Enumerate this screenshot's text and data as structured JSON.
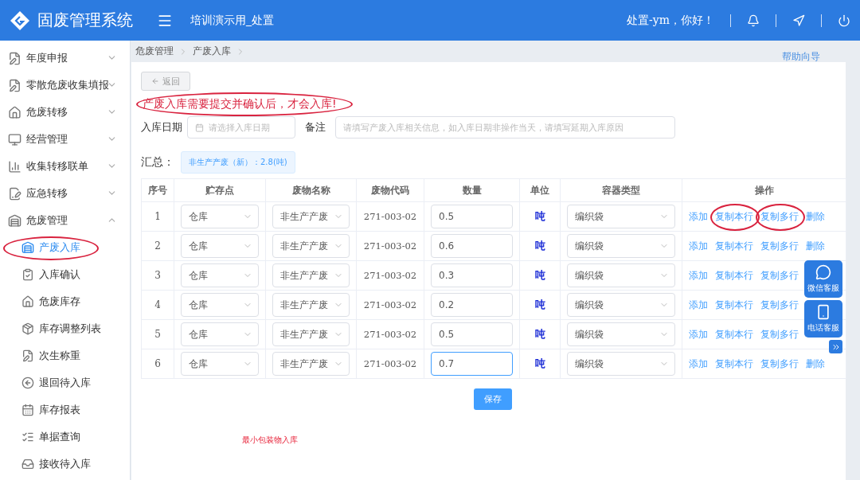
{
  "header": {
    "title": "固废管理系统",
    "org": "培训演示用_处置",
    "greeting": "处置-ym，你好！"
  },
  "sidebar": {
    "items": [
      {
        "label": "年度申报",
        "expanded": false
      },
      {
        "label": "零散危废收集填报",
        "expanded": false
      },
      {
        "label": "危废转移",
        "expanded": false
      },
      {
        "label": "经营管理",
        "expanded": false
      },
      {
        "label": "收集转移联单",
        "expanded": false
      },
      {
        "label": "应急转移",
        "expanded": false
      },
      {
        "label": "危废管理",
        "expanded": true,
        "children": [
          {
            "label": "产废入库",
            "selected": true,
            "circled": true
          },
          {
            "label": "入库确认",
            "selected": false,
            "circled": false
          },
          {
            "label": "危废库存",
            "selected": false,
            "circled": false
          },
          {
            "label": "库存调整列表",
            "selected": false,
            "circled": false
          },
          {
            "label": "次生称重",
            "selected": false,
            "circled": false
          },
          {
            "label": "退回待入库",
            "selected": false,
            "circled": false
          },
          {
            "label": "库存报表",
            "selected": false,
            "circled": false
          },
          {
            "label": "单据查询",
            "selected": false,
            "circled": false
          },
          {
            "label": "接收待入库",
            "selected": false,
            "circled": false
          }
        ]
      }
    ]
  },
  "breadcrumb": [
    "危废管理",
    "产废入库"
  ],
  "help_link": "帮助向导",
  "back_button": "返回",
  "notice": {
    "text": "产废入库需要提交并确认后，才会入库!",
    "circled": true
  },
  "form": {
    "date_label": "入库日期",
    "date_placeholder": "请选择入库日期",
    "remark_label": "备注",
    "remark_placeholder": "请填写产废入库相关信息，如入库日期非操作当天，请填写延期入库原因"
  },
  "summary": {
    "label": "汇总：",
    "tag": "非生产产废（新）：2.8(吨)"
  },
  "table": {
    "columns": [
      "序号",
      "贮存点",
      "废物名称",
      "废物代码",
      "数量",
      "单位",
      "容器类型",
      "操作"
    ],
    "rows": [
      {
        "index": "1",
        "storage": "仓库",
        "waste": "非生产产废",
        "code": "271-003-02",
        "quantity": "0.5",
        "focused": false,
        "unit": "吨",
        "container": "编织袋",
        "actions": [
          {
            "label": "添加",
            "circled": false
          },
          {
            "label": "复制本行",
            "circled": true
          },
          {
            "label": "复制多行",
            "circled": true
          },
          {
            "label": "删除",
            "circled": false
          }
        ]
      },
      {
        "index": "2",
        "storage": "仓库",
        "waste": "非生产产废",
        "code": "271-003-02",
        "quantity": "0.6",
        "focused": false,
        "unit": "吨",
        "container": "编织袋",
        "actions": [
          {
            "label": "添加",
            "circled": false
          },
          {
            "label": "复制本行",
            "circled": false
          },
          {
            "label": "复制多行",
            "circled": false
          },
          {
            "label": "删除",
            "circled": false
          }
        ]
      },
      {
        "index": "3",
        "storage": "仓库",
        "waste": "非生产产废",
        "code": "271-003-02",
        "quantity": "0.3",
        "focused": false,
        "unit": "吨",
        "container": "编织袋",
        "actions": [
          {
            "label": "添加",
            "circled": false
          },
          {
            "label": "复制本行",
            "circled": false
          },
          {
            "label": "复制多行",
            "circled": false
          }
        ]
      },
      {
        "index": "4",
        "storage": "仓库",
        "waste": "非生产产废",
        "code": "271-003-02",
        "quantity": "0.2",
        "focused": false,
        "unit": "吨",
        "container": "编织袋",
        "actions": [
          {
            "label": "添加",
            "circled": false
          },
          {
            "label": "复制本行",
            "circled": false
          },
          {
            "label": "复制多行",
            "circled": false
          }
        ]
      },
      {
        "index": "5",
        "storage": "仓库",
        "waste": "非生产产废",
        "code": "271-003-02",
        "quantity": "0.5",
        "focused": false,
        "unit": "吨",
        "container": "编织袋",
        "actions": [
          {
            "label": "添加",
            "circled": false
          },
          {
            "label": "复制本行",
            "circled": false
          },
          {
            "label": "复制多行",
            "circled": false
          }
        ]
      },
      {
        "index": "6",
        "storage": "仓库",
        "waste": "非生产产废",
        "code": "271-003-02",
        "quantity": "0.7",
        "focused": true,
        "unit": "吨",
        "container": "编织袋",
        "actions": [
          {
            "label": "添加",
            "circled": false
          },
          {
            "label": "复制本行",
            "circled": false
          },
          {
            "label": "复制多行",
            "circled": false
          },
          {
            "label": "删除",
            "circled": false
          }
        ]
      }
    ]
  },
  "save_button": "保存",
  "footer_note": "最小包装物入库",
  "service_widget": [
    "微信客服",
    "电话客服"
  ]
}
